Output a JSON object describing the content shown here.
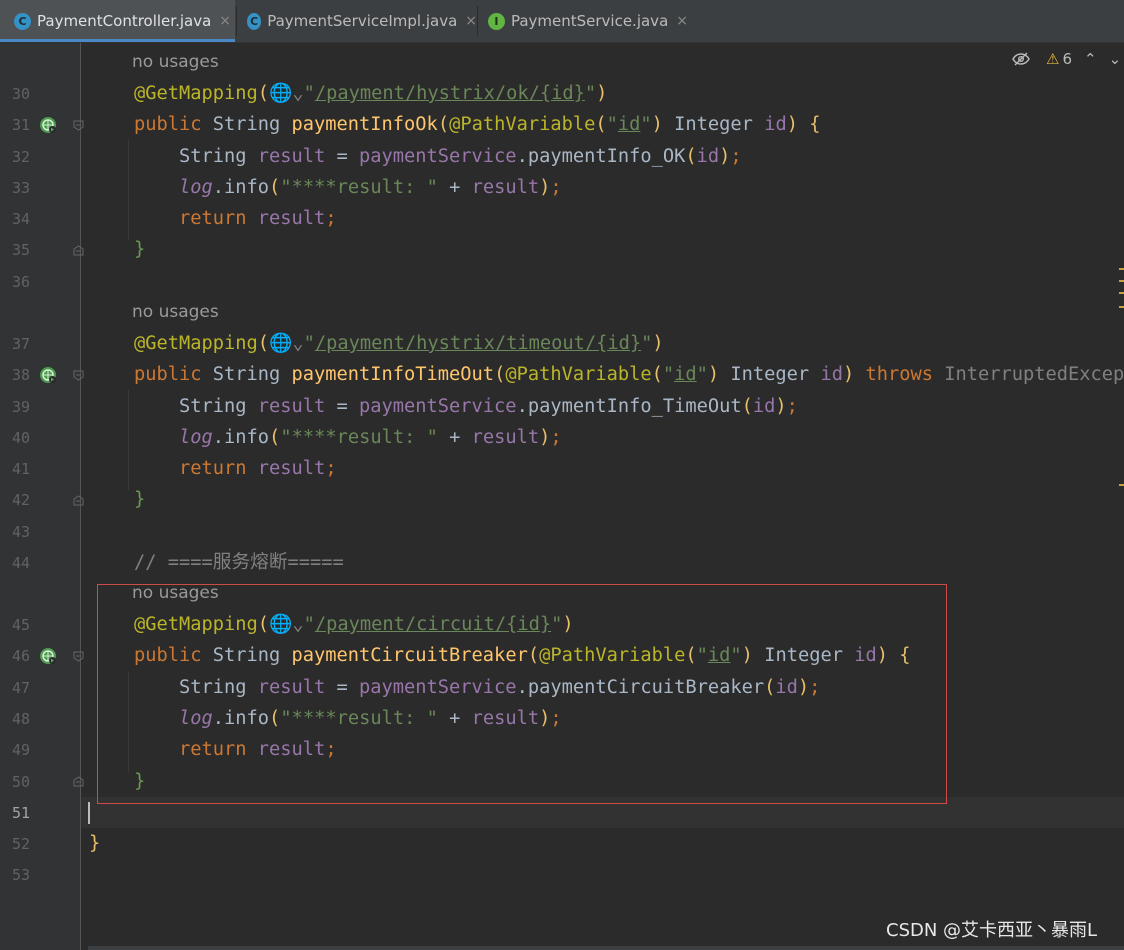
{
  "tabs": [
    {
      "label": "PaymentController.java",
      "icon": "class-icon",
      "icon_letter": "C",
      "active": true
    },
    {
      "label": "PaymentServiceImpl.java",
      "icon": "class-icon",
      "icon_letter": "C",
      "active": false
    },
    {
      "label": "PaymentService.java",
      "icon": "interface-icon",
      "icon_letter": "I",
      "active": false
    }
  ],
  "tab_close": "×",
  "inspection": {
    "warning_count": "6"
  },
  "hints": {
    "no_usages": "no usages"
  },
  "line_numbers": [
    "30",
    "31",
    "32",
    "33",
    "34",
    "35",
    "36",
    "37",
    "38",
    "39",
    "40",
    "41",
    "42",
    "43",
    "44",
    "45",
    "46",
    "47",
    "48",
    "49",
    "50",
    "51",
    "52",
    "53"
  ],
  "code": {
    "annotation": "@GetMapping",
    "path_ok": "/payment/hystrix/ok/{id}",
    "path_timeout": "/payment/hystrix/timeout/{id}",
    "path_circuit": "/payment/circuit/{id}",
    "method_ok": "paymentInfoOk",
    "method_timeout": "paymentInfoTimeOut",
    "method_circuit": "paymentCircuitBreaker",
    "call_ok": "paymentInfo_OK",
    "call_timeout": "paymentInfo_TimeOut",
    "call_circuit": "paymentCircuitBreaker",
    "path_variable": "@PathVariable",
    "id_literal": "id",
    "throws_kw": "throws",
    "exception": "InterruptedExceptio",
    "log_string": "\"****result: \"",
    "comment": "// ====服务熔断====="
  },
  "watermark": "CSDN @艾卡西亚丶暴雨L",
  "colors": {
    "keyword": "#cc7832",
    "string": "#6a8759",
    "field": "#9876aa",
    "annotation": "#bbb529",
    "function": "#ffc66d",
    "highlight_box": "#d04a4a"
  }
}
